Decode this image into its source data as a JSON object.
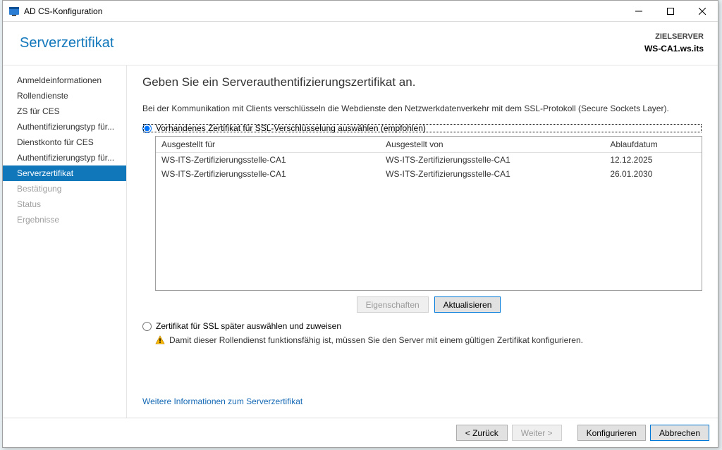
{
  "window": {
    "title": "AD CS-Konfiguration"
  },
  "header": {
    "page_title": "Serverzertifikat",
    "target_label": "ZIELSERVER",
    "target_server": "WS-CA1.ws.its"
  },
  "nav": {
    "items": [
      {
        "label": "Anmeldeinformationen",
        "state": "normal"
      },
      {
        "label": "Rollendienste",
        "state": "normal"
      },
      {
        "label": "ZS für CES",
        "state": "normal"
      },
      {
        "label": "Authentifizierungstyp für...",
        "state": "normal"
      },
      {
        "label": "Dienstkonto für CES",
        "state": "normal"
      },
      {
        "label": "Authentifizierungstyp für...",
        "state": "normal"
      },
      {
        "label": "Serverzertifikat",
        "state": "selected"
      },
      {
        "label": "Bestätigung",
        "state": "disabled"
      },
      {
        "label": "Status",
        "state": "disabled"
      },
      {
        "label": "Ergebnisse",
        "state": "disabled"
      }
    ]
  },
  "main": {
    "heading": "Geben Sie ein Serverauthentifizierungszertifikat an.",
    "description": "Bei der Kommunikation mit Clients verschlüsseln die Webdienste den Netzwerkdatenverkehr mit dem SSL-Protokoll (Secure Sockets Layer).",
    "radio_existing": "Vorhandenes Zertifikat für SSL-Verschlüsselung auswählen (empfohlen)",
    "table": {
      "col_issued_for": "Ausgestellt für",
      "col_issued_by": "Ausgestellt von",
      "col_expires": "Ablaufdatum",
      "rows": [
        {
          "for": "WS-ITS-Zertifizierungsstelle-CA1",
          "by": "WS-ITS-Zertifizierungsstelle-CA1",
          "exp": "12.12.2025"
        },
        {
          "for": "WS-ITS-Zertifizierungsstelle-CA1",
          "by": "WS-ITS-Zertifizierungsstelle-CA1",
          "exp": "26.01.2030"
        }
      ]
    },
    "btn_properties": "Eigenschaften",
    "btn_refresh": "Aktualisieren",
    "radio_later": "Zertifikat für SSL später auswählen und zuweisen",
    "warning_text": "Damit dieser Rollendienst funktionsfähig ist, müssen Sie den Server mit einem gültigen Zertifikat konfigurieren.",
    "more_link": "Weitere Informationen zum Serverzertifikat"
  },
  "footer": {
    "back": "< Zurück",
    "next": "Weiter >",
    "configure": "Konfigurieren",
    "cancel": "Abbrechen"
  }
}
